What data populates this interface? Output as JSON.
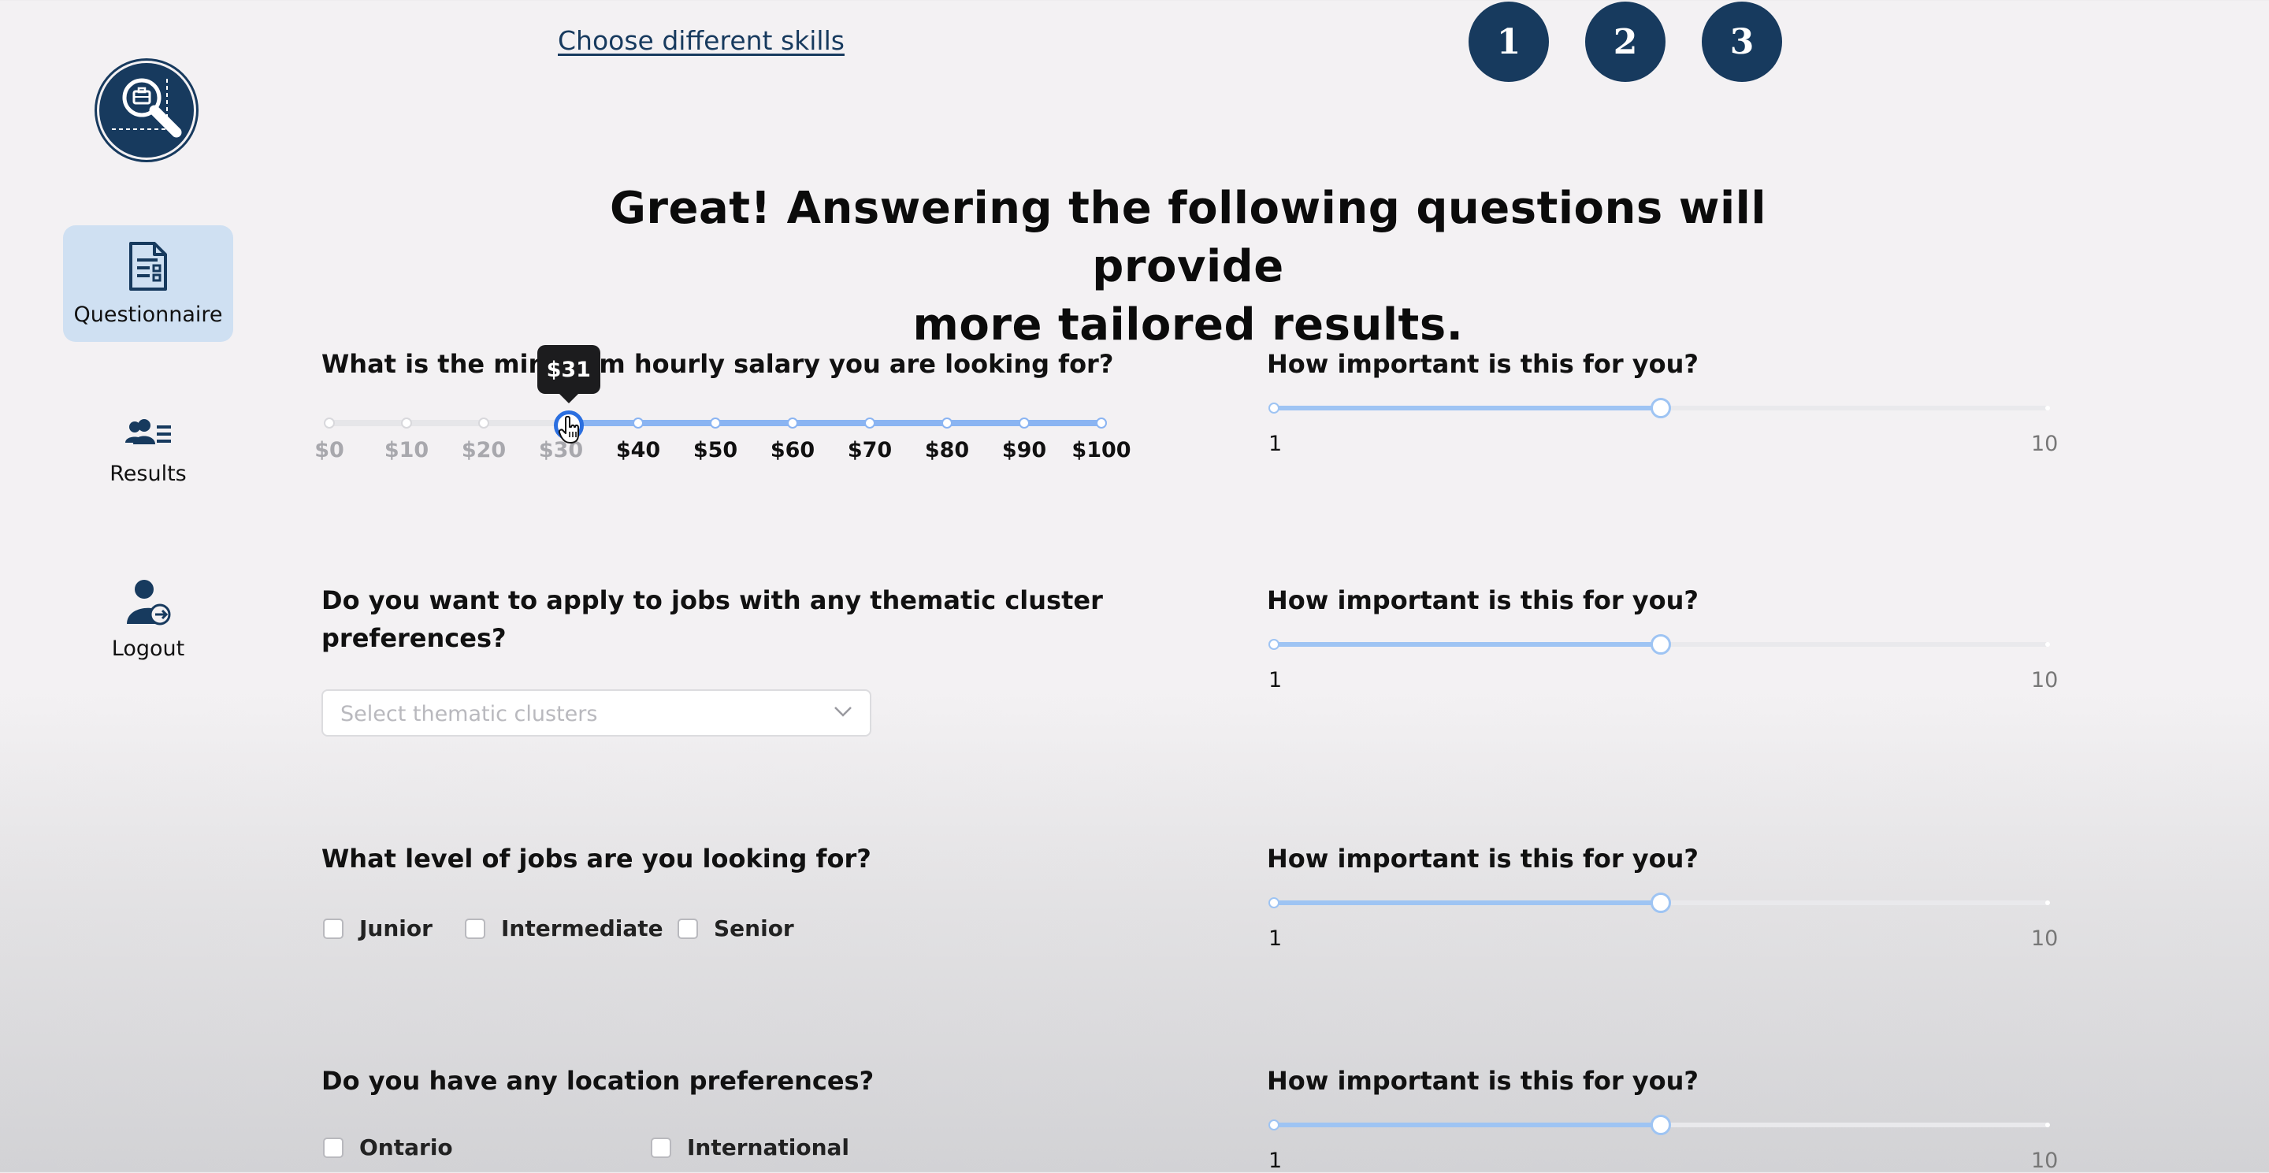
{
  "top": {
    "change_skills_link": "Choose different skills",
    "steps": [
      "1",
      "2",
      "3"
    ]
  },
  "sidebar": {
    "items": [
      {
        "label": "Questionnaire",
        "icon": "document-icon",
        "active": true
      },
      {
        "label": "Results",
        "icon": "users-list-icon",
        "active": false
      },
      {
        "label": "Logout",
        "icon": "user-logout-icon",
        "active": false
      }
    ]
  },
  "headline": {
    "line1": "Great! Answering the following questions will provide",
    "line2": "more tailored results."
  },
  "salary": {
    "question": "What is the minimum hourly salary you are looking for?",
    "marks": [
      "$0",
      "$10",
      "$20",
      "$30",
      "$40",
      "$50",
      "$60",
      "$70",
      "$80",
      "$90",
      "$100"
    ],
    "value": 31,
    "min": 0,
    "max": 100,
    "tooltip": "$31"
  },
  "thematic": {
    "question_line1": "Do you want to apply to jobs with any thematic cluster",
    "question_line2": "preferences?",
    "placeholder": "Select thematic clusters"
  },
  "level": {
    "question": "What level of jobs are you looking for?",
    "options": [
      "Junior",
      "Intermediate",
      "Senior"
    ]
  },
  "location": {
    "question": "Do you have any location preferences?",
    "options": [
      "Ontario",
      "International"
    ]
  },
  "importance": {
    "question": "How important is this for you?",
    "min_label": "1",
    "max_label": "10",
    "value": 5.5
  },
  "colors": {
    "brand": "#173a5e",
    "accent": "#2b6fe0",
    "track": "#8ab4f2",
    "active_nav": "#cfe0f2"
  }
}
